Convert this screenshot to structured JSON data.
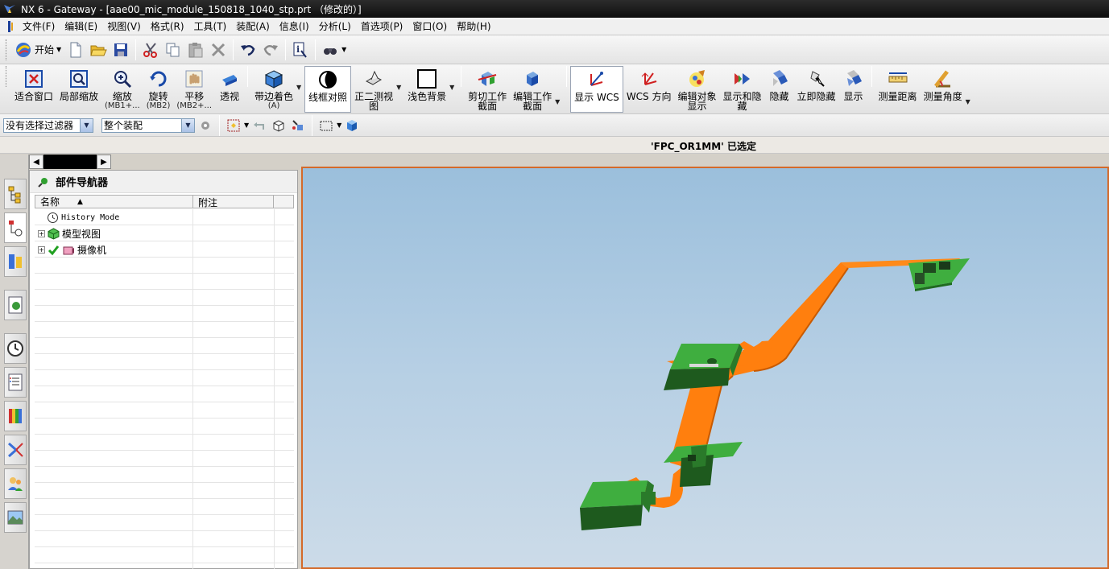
{
  "window": {
    "title": "NX 6 - Gateway - [aae00_mic_module_150818_1040_stp.prt （修改的）]"
  },
  "menu": [
    "文件(F)",
    "编辑(E)",
    "视图(V)",
    "格式(R)",
    "工具(T)",
    "装配(A)",
    "信息(I)",
    "分析(L)",
    "首选项(P)",
    "窗口(O)",
    "帮助(H)"
  ],
  "standard_toolbar": {
    "start_label": "开始"
  },
  "view_toolbar": {
    "buttons": [
      {
        "label": "适合窗口",
        "sub": ""
      },
      {
        "label": "局部缩放",
        "sub": ""
      },
      {
        "label": "缩放",
        "sub": "(MB1+..."
      },
      {
        "label": "旋转",
        "sub": "(MB2)"
      },
      {
        "label": "平移",
        "sub": "(MB2+..."
      },
      {
        "label": "透视",
        "sub": ""
      },
      {
        "label": "带边着色",
        "sub": "(A)"
      },
      {
        "label": "线框对照",
        "sub": ""
      },
      {
        "label": "正二测视",
        "label2": "图"
      },
      {
        "label": "浅色背景",
        "sub": ""
      },
      {
        "label": "剪切工作",
        "label2": "截面"
      },
      {
        "label": "编辑工作",
        "label2": "截面"
      },
      {
        "label": "显示 WCS",
        "sub": ""
      },
      {
        "label": "WCS 方向",
        "sub": ""
      },
      {
        "label": "编辑对象",
        "label2": "显示"
      },
      {
        "label": "显示和隐",
        "label2": "藏"
      },
      {
        "label": "隐藏",
        "sub": ""
      },
      {
        "label": "立即隐藏",
        "sub": ""
      },
      {
        "label": "显示",
        "sub": ""
      },
      {
        "label": "测量距离",
        "sub": ""
      },
      {
        "label": "测量角度",
        "sub": ""
      }
    ]
  },
  "selection_bar": {
    "filter_value": "没有选择过滤器",
    "scope_value": "整个装配"
  },
  "status": {
    "message": "'FPC_OR1MM' 已选定"
  },
  "part_navigator": {
    "title": "部件导航器",
    "columns": {
      "name": "名称",
      "notes": "附注"
    },
    "nodes": [
      {
        "label": "History Mode"
      },
      {
        "label": "模型视图"
      },
      {
        "label": "摄像机"
      }
    ]
  },
  "colors": {
    "graphics_border": "#d46a2a",
    "flex_cable": "#ff7f0e",
    "component_green": "#3fae3f"
  }
}
